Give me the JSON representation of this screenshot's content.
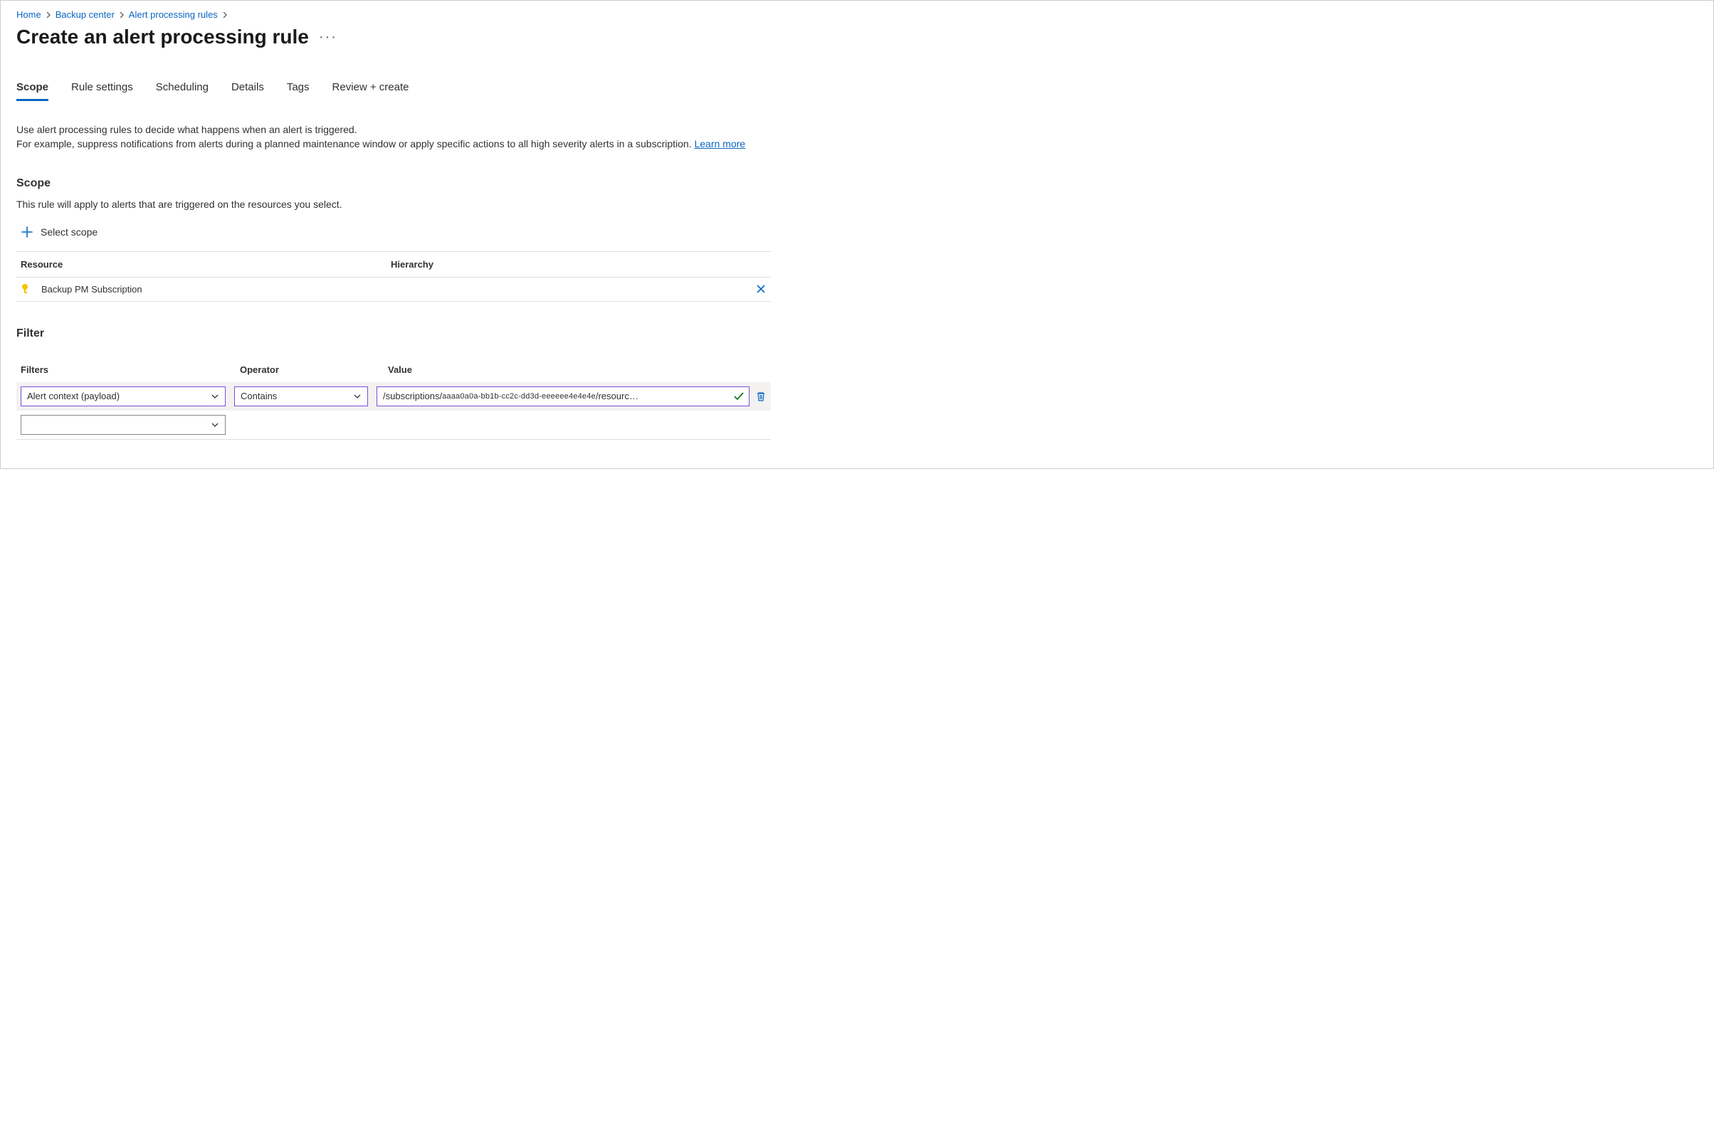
{
  "breadcrumb": {
    "home": "Home",
    "backup_center": "Backup center",
    "alert_processing_rules": "Alert processing rules"
  },
  "page": {
    "title": "Create an alert processing rule"
  },
  "tabs": {
    "scope": "Scope",
    "rule_settings": "Rule settings",
    "scheduling": "Scheduling",
    "details": "Details",
    "tags": "Tags",
    "review_create": "Review + create"
  },
  "intro": {
    "line1": "Use alert processing rules to decide what happens when an alert is triggered.",
    "line2": "For example, suppress notifications from alerts during a planned maintenance window or apply specific actions to all high severity alerts in a subscription. ",
    "learn_more": "Learn more"
  },
  "scope": {
    "heading": "Scope",
    "subtext": "This rule will apply to alerts that are triggered on the resources you select.",
    "select_scope": "Select scope",
    "col_resource": "Resource",
    "col_hierarchy": "Hierarchy",
    "row_resource": "Backup PM Subscription"
  },
  "filter": {
    "heading": "Filter",
    "col_filters": "Filters",
    "col_operator": "Operator",
    "col_value": "Value",
    "row0": {
      "filter_selected": "Alert context (payload)",
      "operator_selected": "Contains",
      "value_prefix": "/subscriptions/",
      "value_mono": "aaaa0a0a-bb1b-cc2c-dd3d-eeeeee4e4e4e",
      "value_suffix": " /resourc…"
    }
  }
}
